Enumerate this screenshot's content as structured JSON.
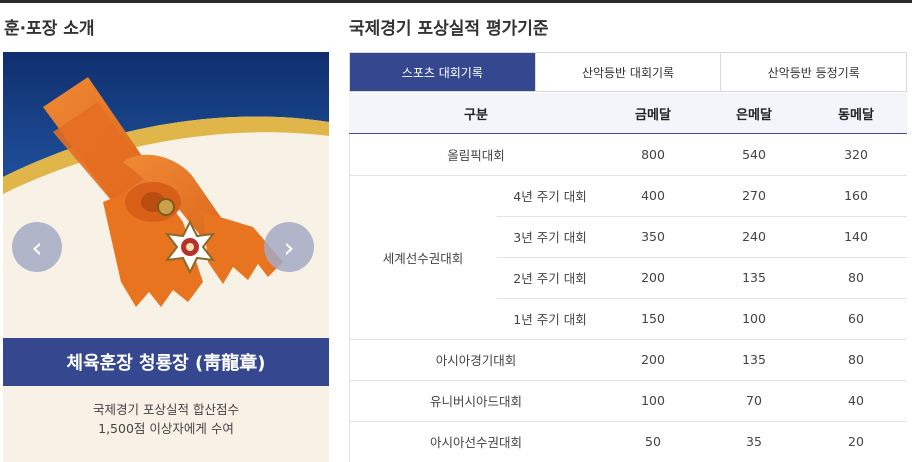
{
  "left": {
    "title": "훈·포장 소개",
    "medal_name": "체육훈장 청룡장 (靑龍章)",
    "desc_line1": "국제경기 포상실적 합산점수",
    "desc_line2": "1,500점 이상자에게 수여",
    "prev_label": "‹",
    "next_label": "›"
  },
  "right": {
    "title": "국제경기 포상실적 평가기준",
    "tabs": [
      "스포츠 대회기록",
      "산악등반 대회기록",
      "산악등반 등정기록"
    ],
    "active_tab": 0,
    "headers": [
      "구분",
      "금메달",
      "은메달",
      "동메달"
    ],
    "rows": [
      {
        "category": "올림픽대회",
        "gold": "800",
        "silver": "540",
        "bronze": "320"
      },
      {
        "category": "세계선수권대회",
        "sub": "4년 주기 대회",
        "gold": "400",
        "silver": "270",
        "bronze": "160"
      },
      {
        "category": "",
        "sub": "3년 주기 대회",
        "gold": "350",
        "silver": "240",
        "bronze": "140"
      },
      {
        "category": "",
        "sub": "2년 주기 대회",
        "gold": "200",
        "silver": "135",
        "bronze": "80"
      },
      {
        "category": "",
        "sub": "1년 주기 대회",
        "gold": "150",
        "silver": "100",
        "bronze": "60"
      },
      {
        "category": "아시아경기대회",
        "gold": "200",
        "silver": "135",
        "bronze": "80"
      },
      {
        "category": "유니버시아드대회",
        "gold": "100",
        "silver": "70",
        "bronze": "40"
      },
      {
        "category": "아시아선수권대회",
        "gold": "50",
        "silver": "35",
        "bronze": "20"
      }
    ]
  },
  "colors": {
    "accent": "#34478f",
    "ribbon": "#e8741f",
    "gold_band": "#e0b54a"
  }
}
